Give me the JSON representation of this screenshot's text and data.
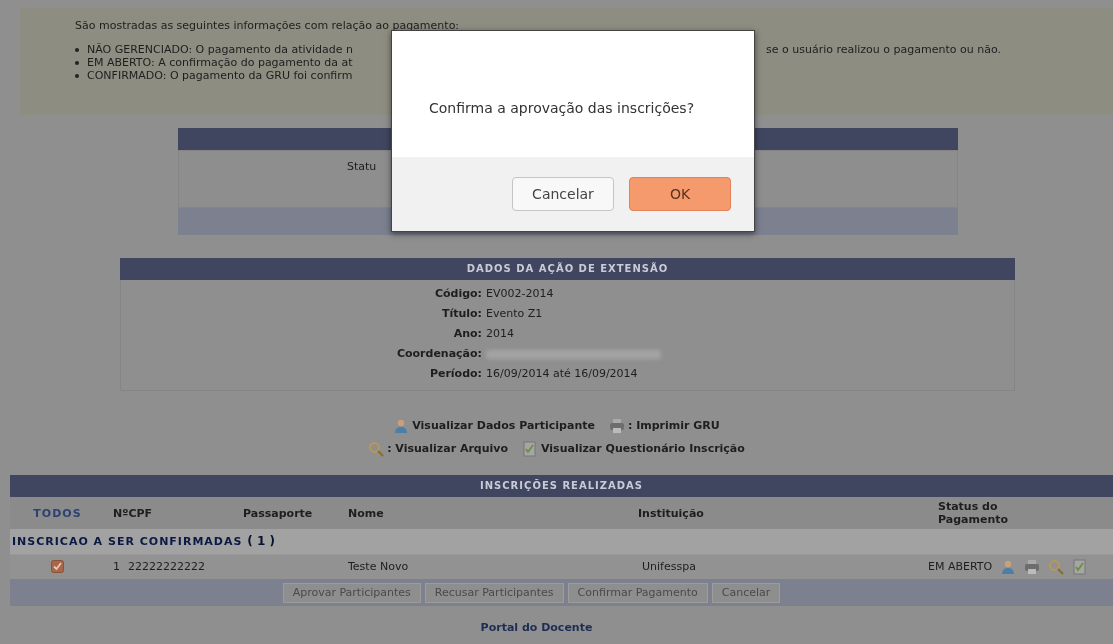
{
  "notice": {
    "intro": "São mostradas as seguintes informações com relação ao pagamento:",
    "items": [
      {
        "text": "NÃO GERENCIADO: O pagamento da atividade n",
        "continuation": "se o usuário realizou o pagamento ou não."
      },
      {
        "text": "EM ABERTO: A confirmação do pagamento da at"
      },
      {
        "text": "CONFIRMADO: O pagamento da GRU foi confirm"
      }
    ]
  },
  "status_panel": {
    "label": "Statu"
  },
  "dialog": {
    "message": "Confirma a aprovação das inscrições?",
    "buttons": [
      {
        "label": "Cancelar",
        "kind": "secondary"
      },
      {
        "label": "OK",
        "kind": "primary"
      }
    ]
  },
  "action_details": {
    "title": "DADOS DA AÇÃO DE EXTENSÃO",
    "fields": [
      {
        "label": "Código:",
        "value": "EV002-2014"
      },
      {
        "label": "Título:",
        "value": "Evento Z1"
      },
      {
        "label": "Ano:",
        "value": "2014"
      },
      {
        "label": "Coordenação:",
        "blurred": true
      },
      {
        "label": "Período:",
        "value": "16/09/2014 até 16/09/2014"
      }
    ]
  },
  "legend": [
    [
      {
        "kind": "person",
        "text": "Visualizar Dados Participante"
      },
      {
        "kind": "printer",
        "text": ": Imprimir GRU"
      }
    ],
    [
      {
        "kind": "magnifier",
        "text": ": Visualizar Arquivo"
      },
      {
        "kind": "form",
        "text": "Visualizar Questionário Inscrição"
      }
    ]
  ],
  "registrations": {
    "title": "INSCRIÇÕES REALIZADAS",
    "columns": [
      "TODOS",
      "NºCPF",
      "Passaporte",
      "Nome",
      "Instituição",
      "Status do Pagamento"
    ],
    "groups": [
      {
        "title": "INSCRICAO A SER CONFIRMADAS",
        "count": "( 1 )",
        "rows": [
          {
            "checked": true,
            "number": "1",
            "cpf": "22222222222",
            "name": "Teste Novo",
            "institution": "Unifesspa",
            "payment_status": "EM ABERTO"
          }
        ]
      }
    ],
    "buttons": [
      "Aprovar Participantes",
      "Recusar Participantes",
      "Confirmar Pagamento",
      "Cancelar"
    ]
  },
  "footer_link": "Portal do Docente"
}
